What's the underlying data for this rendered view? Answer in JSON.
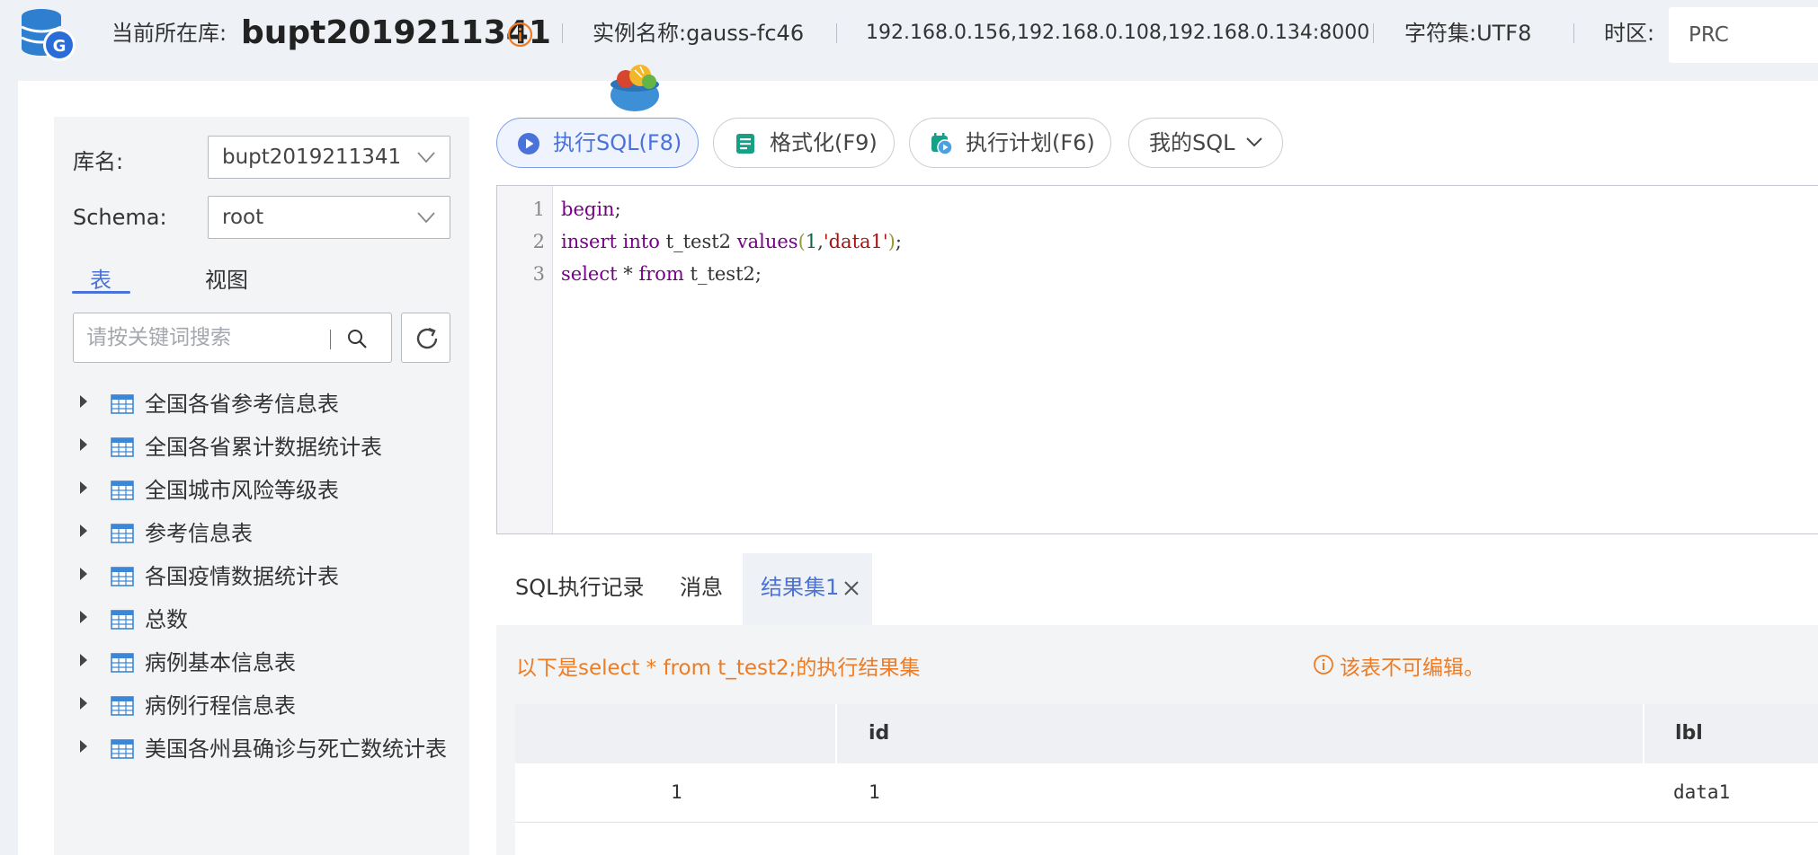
{
  "topbar": {
    "current_db_label": "当前所在库:",
    "current_db": "bupt2019211341",
    "instance_label": "实例名称:gauss-fc46",
    "address": "192.168.0.156,192.168.0.108,192.168.0.134:8000",
    "charset": "字符集:UTF8",
    "timezone_label": "时区:",
    "timezone": "PRC"
  },
  "sidebar": {
    "db_label": "库名:",
    "db_value": "bupt2019211341",
    "schema_label": "Schema:",
    "schema_value": "root",
    "tab_tables": "表",
    "tab_views": "视图",
    "search_placeholder": "请按关键词搜索",
    "tables": [
      "全国各省参考信息表",
      "全国各省累计数据统计表",
      "全国城市风险等级表",
      "参考信息表",
      "各国疫情数据统计表",
      "总数",
      "病例基本信息表",
      "病例行程信息表",
      "美国各州县确诊与死亡数统计表"
    ]
  },
  "toolbar": {
    "run_sql": "执行SQL(F8)",
    "format": "格式化(F9)",
    "explain": "执行计划(F6)",
    "my_sql": "我的SQL"
  },
  "editor": {
    "line_numbers": [
      "1",
      "2",
      "3"
    ],
    "line1": {
      "kw": "begin",
      "rest": ";"
    },
    "line2": {
      "kw1": "insert",
      "kw2": "into",
      "table": "t_test2",
      "kw3": "values",
      "open": "(",
      "num": "1",
      "comma": ",",
      "str": "'data1'",
      "close": ")",
      "end": ";"
    },
    "line3": {
      "kw1": "select",
      "star": "*",
      "kw2": "from",
      "table": "t_test2",
      "end": ";"
    }
  },
  "results": {
    "tab_history": "SQL执行记录",
    "tab_messages": "消息",
    "tab_result": "结果集1",
    "message": "以下是select * from t_test2;的执行结果集",
    "readonly_note": "该表不可编辑。",
    "columns": [
      "",
      "id",
      "lbl"
    ],
    "rows": [
      [
        "1",
        "1",
        "data1"
      ]
    ]
  },
  "colors": {
    "accent": "#4a72d9",
    "warning": "#f07b22",
    "info_icon": "#f07b22"
  }
}
